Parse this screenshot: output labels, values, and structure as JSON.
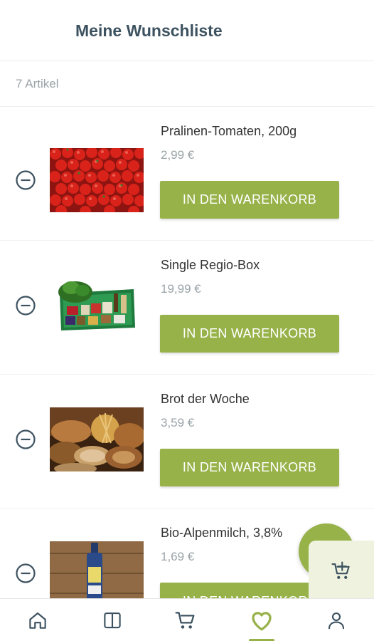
{
  "header": {
    "title": "Meine Wunschliste"
  },
  "list": {
    "count": "7 Artikel"
  },
  "items": [
    {
      "name": "Pralinen-Tomaten, 200g",
      "price": "2,99 €",
      "button": "IN DEN WARENKORB",
      "image": "tomatoes"
    },
    {
      "name": "Single Regio-Box",
      "price": "19,99 €",
      "button": "IN DEN WARENKORB",
      "image": "vegetable-box"
    },
    {
      "name": "Brot der Woche",
      "price": "3,59 €",
      "button": "IN DEN WARENKORB",
      "image": "bread"
    },
    {
      "name": "Bio-Alpenmilch, 3,8%",
      "price": "1,69 €",
      "button": "IN DEN WARENKORB",
      "image": "milk-bottle"
    }
  ],
  "fab": {
    "icon": "cart-plus-icon"
  },
  "nav": {
    "items": [
      {
        "icon": "home-icon"
      },
      {
        "icon": "catalog-icon"
      },
      {
        "icon": "cart-icon"
      },
      {
        "icon": "heart-icon",
        "active": true
      },
      {
        "icon": "user-icon"
      }
    ]
  },
  "colors": {
    "accent": "#98b24a",
    "title": "#3d5260",
    "muted": "#9aa3a8",
    "panel": "#eef2de"
  }
}
